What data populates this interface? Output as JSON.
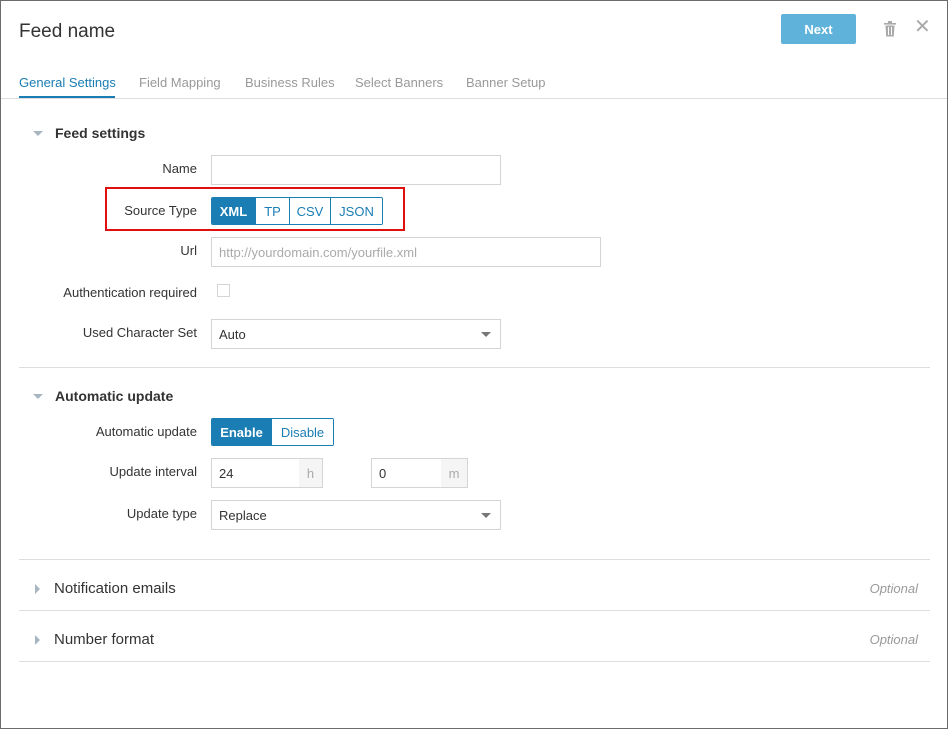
{
  "header": {
    "title": "Feed name",
    "next_label": "Next"
  },
  "tabs": [
    {
      "label": "General Settings",
      "active": true
    },
    {
      "label": "Field Mapping"
    },
    {
      "label": "Business Rules"
    },
    {
      "label": "Select Banners"
    },
    {
      "label": "Banner Setup"
    }
  ],
  "feed_settings": {
    "title": "Feed settings",
    "name_label": "Name",
    "name_value": "",
    "source_type_label": "Source Type",
    "source_types": [
      "XML",
      "TP",
      "CSV",
      "JSON"
    ],
    "source_type_selected": "XML",
    "url_label": "Url",
    "url_placeholder": "http://yourdomain.com/yourfile.xml",
    "auth_label": "Authentication required",
    "auth_checked": false,
    "charset_label": "Used Character Set",
    "charset_value": "Auto"
  },
  "automatic_update": {
    "title": "Automatic update",
    "toggle_label": "Automatic update",
    "enable_label": "Enable",
    "disable_label": "Disable",
    "selected": "Enable",
    "interval_label": "Update interval",
    "hours_value": "24",
    "hours_unit": "h",
    "minutes_value": "0",
    "minutes_unit": "m",
    "type_label": "Update type",
    "type_value": "Replace"
  },
  "notification": {
    "title": "Notification emails",
    "optional": "Optional"
  },
  "number_format": {
    "title": "Number format",
    "optional": "Optional"
  },
  "colors": {
    "accent": "#1a7db4",
    "next_button": "#5fb3db",
    "highlight": "#e01010"
  }
}
